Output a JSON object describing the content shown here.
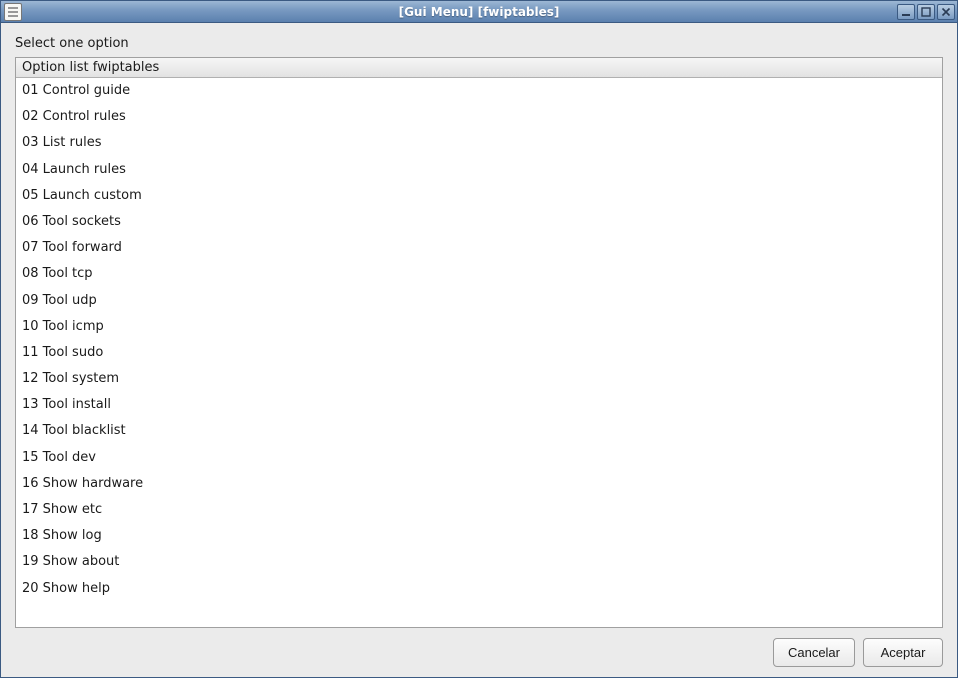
{
  "window": {
    "title": "[Gui Menu]  [fwiptables]"
  },
  "prompt": "Select one option",
  "list": {
    "header": "Option list fwiptables",
    "items": [
      "01 Control guide",
      "02 Control rules",
      "03 List rules",
      "04 Launch rules",
      "05 Launch custom",
      "06 Tool sockets",
      "07 Tool forward",
      "08 Tool tcp",
      "09 Tool udp",
      "10 Tool icmp",
      "11 Tool sudo",
      "12 Tool system",
      "13 Tool install",
      "14 Tool blacklist",
      "15 Tool dev",
      "16 Show hardware",
      "17 Show etc",
      "18 Show log",
      "19 Show about",
      "20 Show help"
    ]
  },
  "buttons": {
    "cancel": "Cancelar",
    "accept": "Aceptar"
  }
}
